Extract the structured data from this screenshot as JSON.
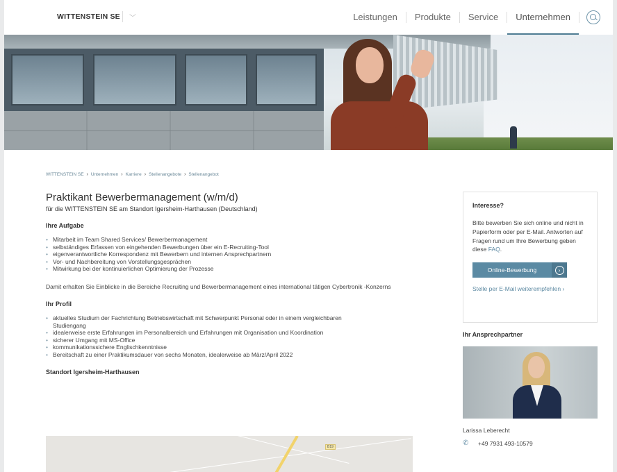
{
  "header": {
    "brand": "WITTENSTEIN SE",
    "nav": [
      "Leistungen",
      "Produkte",
      "Service",
      "Unternehmen"
    ],
    "active_nav": "Unternehmen"
  },
  "breadcrumb": [
    "WITTENSTEIN SE",
    "Unternehmen",
    "Karriere",
    "Stellenangebote",
    "Stellenangebot"
  ],
  "job": {
    "title": "Praktikant Bewerbermanagement (w/m/d)",
    "subtitle": "für die WITTENSTEIN SE am Standort Igersheim-Harthausen (Deutschland)",
    "tasks_heading": "Ihre Aufgabe",
    "tasks": [
      "Mitarbeit im Team Shared Services/ Bewerbermanagement",
      "selbständiges Erfassen von eingehenden Bewerbungen über ein E-Recruiting-Tool",
      "eigenverantwortliche Korrespondenz mit Bewerbern und internen Ansprechpartnern",
      "Vor- und Nachbereitung von Vorstellungsgesprächen",
      "Mitwirkung bei der kontinuierlichen Optimierung der Prozesse"
    ],
    "insight_text": "Damit erhalten Sie Einblicke in die Bereiche Recruiting und Bewerbermanagement eines international tätigen Cybertronik -Konzerns",
    "profile_heading": "Ihr Profil",
    "profile": [
      "aktuelles Studium der Fachrichtung Betriebswirtschaft mit Schwerpunkt Personal oder in einem vergleichbaren Studiengang",
      "idealerweise erste Erfahrungen im Personalbereich und Erfahrungen mit Organisation und Koordination",
      "sicherer Umgang mit MS-Office",
      "kommunikationssichere Englischkenntnisse",
      "Bereitschaft zu einer Praktikumsdauer von sechs Monaten, idealerweise ab März/April 2022"
    ],
    "location_heading": "Standort Igersheim-Harthausen",
    "map_badge": "B19"
  },
  "sidebar": {
    "interest_heading": "Interesse?",
    "interest_text": "Bitte bewerben Sie sich online und nicht in Papierform oder per E-Mail. Antworten auf Fragen rund um Ihre Bewerbung geben diese ",
    "faq_link": "FAQ",
    "faq_suffix": ".",
    "apply_button": "Online-Bewerbung",
    "apply_arrow": "›",
    "recommend_link": "Stelle per E-Mail weiterempfehlen ›",
    "contact_heading": "Ihr Ansprechpartner",
    "contact_name": "Larissa Leberecht",
    "contact_phone": "+49 7931 493-10579"
  }
}
